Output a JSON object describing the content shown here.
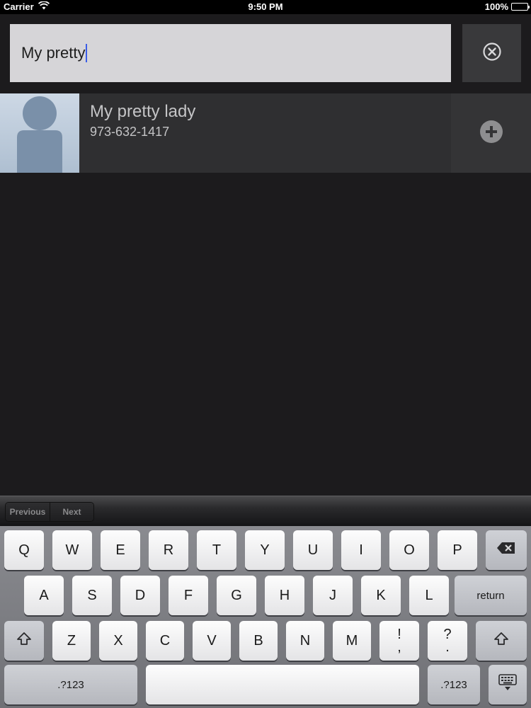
{
  "status_bar": {
    "carrier": "Carrier",
    "time": "9:50 PM",
    "battery": "100%",
    "battery_level": 1.0
  },
  "search": {
    "value": "My pretty",
    "clear_icon": "circle-x-icon"
  },
  "results": [
    {
      "name": "My pretty lady",
      "phone": "973-632-1417",
      "action_icon": "plus-circle-icon"
    }
  ],
  "toolbar": {
    "previous_label": "Previous",
    "next_label": "Next"
  },
  "keyboard": {
    "row1": [
      "Q",
      "W",
      "E",
      "R",
      "T",
      "Y",
      "U",
      "I",
      "O",
      "P"
    ],
    "row2": [
      "A",
      "S",
      "D",
      "F",
      "G",
      "H",
      "J",
      "K",
      "L"
    ],
    "row3": [
      "Z",
      "X",
      "C",
      "V",
      "B",
      "N",
      "M"
    ],
    "row3_punct1": [
      "!",
      ","
    ],
    "row3_punct2": [
      "?",
      "."
    ],
    "return_label": "return",
    "numbers_label": ".?123"
  },
  "colors": {
    "background": "#1c1b1d",
    "search_field": "#d6d5d8",
    "row": "#2f2f31",
    "caret": "#3b5de7"
  }
}
